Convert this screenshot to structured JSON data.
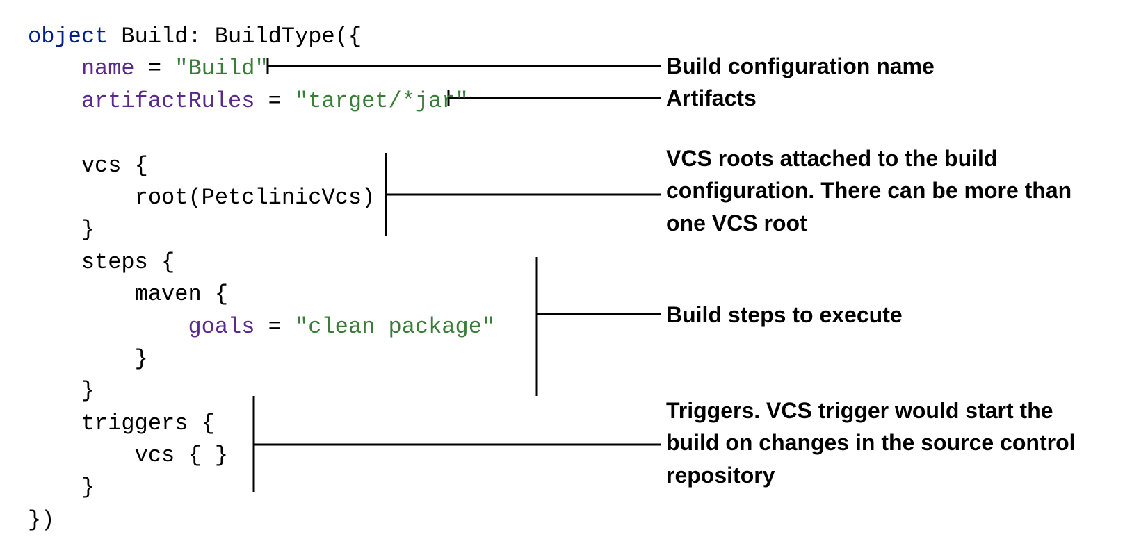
{
  "code": {
    "kw_object": "object",
    "classname": " Build: BuildType({",
    "indent1": "    ",
    "indent2": "        ",
    "indent3": "            ",
    "prop_name": "name",
    "eq": " = ",
    "str_build": "\"Build\"",
    "prop_artifact": "artifactRules",
    "str_artifact": "\"target/*jar\"",
    "vcs_open": "vcs {",
    "root_call": "root(PetclinicVcs)",
    "close_brace": "}",
    "steps_open": "steps {",
    "maven_open": "maven {",
    "prop_goals": "goals",
    "str_goals": "\"clean package\"",
    "triggers_open": "triggers {",
    "vcs_empty": "vcs { }",
    "close_paren": "})"
  },
  "annotations": {
    "a1": "Build configuration name",
    "a2": "Artifacts",
    "a3": "VCS roots attached to the build configuration. There can be more than one VCS root",
    "a4": "Build steps to execute",
    "a5": "Triggers. VCS trigger would start the build on changes in the source control repository"
  }
}
